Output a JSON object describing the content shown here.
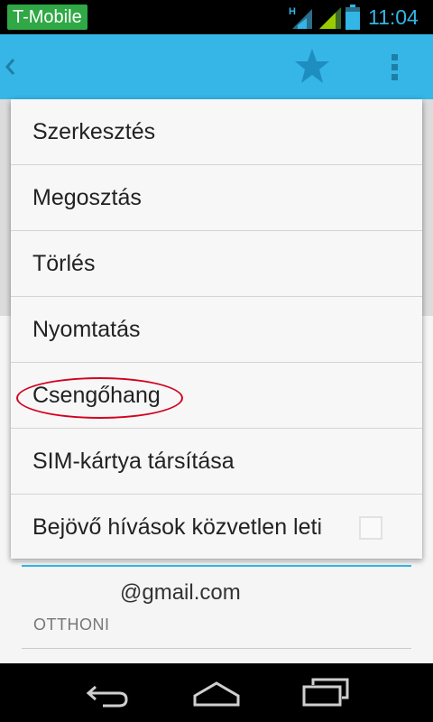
{
  "status_bar": {
    "carrier": "T-Mobile",
    "network_indicator": "H",
    "time": "11:04"
  },
  "action_bar": {
    "color": "#35b6e6",
    "icons": [
      "back-icon",
      "star-icon",
      "overflow-menu-icon"
    ]
  },
  "menu": {
    "items": [
      {
        "label": "Szerkesztés"
      },
      {
        "label": "Megosztás"
      },
      {
        "label": "Törlés"
      },
      {
        "label": "Nyomtatás"
      },
      {
        "label": "Csengőhang",
        "highlighted": true
      },
      {
        "label": "SIM-kártya társítása"
      },
      {
        "label": "Bejövő hívások közvetlen leti",
        "checkbox": false
      }
    ]
  },
  "contact": {
    "email": "@gmail.com",
    "email_type": "OTTHONI"
  },
  "navigation_bar": {
    "icons": [
      "back-icon",
      "home-icon",
      "recent-apps-icon"
    ]
  },
  "colors": {
    "accent": "#33b5e5",
    "highlight_ring": "#d3001f",
    "carrier_badge": "#2fa845"
  }
}
